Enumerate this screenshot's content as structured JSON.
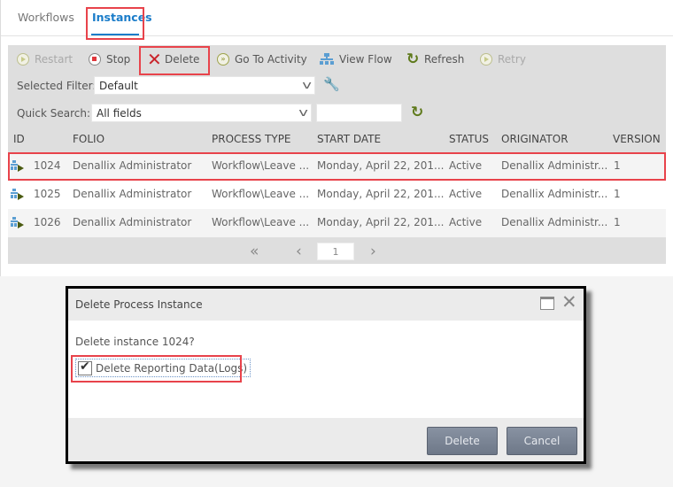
{
  "tabs": [
    {
      "label": "Workflows",
      "active": false
    },
    {
      "label": "Instances",
      "active": true
    }
  ],
  "toolbar": {
    "restart": "Restart",
    "stop": "Stop",
    "delete": "Delete",
    "goto_activity": "Go To Activity",
    "view_flow": "View Flow",
    "refresh": "Refresh",
    "retry": "Retry"
  },
  "filter": {
    "selected_filter_label": "Selected Filter:",
    "selected_filter_value": "Default",
    "quick_search_label": "Quick Search:",
    "quick_search_field": "All fields",
    "quick_search_value": ""
  },
  "grid": {
    "columns": [
      "ID",
      "FOLIO",
      "PROCESS TYPE",
      "START DATE",
      "STATUS",
      "ORIGINATOR",
      "VERSION"
    ],
    "rows": [
      {
        "id": "1024",
        "folio": "Denallix Administrator",
        "process_type": "Workflow\\Leave ...",
        "start_date": "Monday, April 22, 201...",
        "status": "Active",
        "originator": "Denallix Administr...",
        "version": "1",
        "selected": true
      },
      {
        "id": "1025",
        "folio": "Denallix Administrator",
        "process_type": "Workflow\\Leave ...",
        "start_date": "Monday, April 22, 201...",
        "status": "Active",
        "originator": "Denallix Administr...",
        "version": "1",
        "selected": false
      },
      {
        "id": "1026",
        "folio": "Denallix Administrator",
        "process_type": "Workflow\\Leave ...",
        "start_date": "Monday, April 22, 201...",
        "status": "Active",
        "originator": "Denallix Administr...",
        "version": "1",
        "selected": false
      }
    ]
  },
  "pager": {
    "first": "«",
    "prev": "‹",
    "page": "1",
    "next": "›"
  },
  "dialog": {
    "title": "Delete Process Instance",
    "message": "Delete instance 1024?",
    "checkbox_label": "Delete Reporting Data(Logs)",
    "checkbox_checked": true,
    "delete_button": "Delete",
    "cancel_button": "Cancel"
  },
  "colors": {
    "accent": "#1a7cc9",
    "highlight": "#e8434b",
    "delete_icon": "#c9232a"
  }
}
